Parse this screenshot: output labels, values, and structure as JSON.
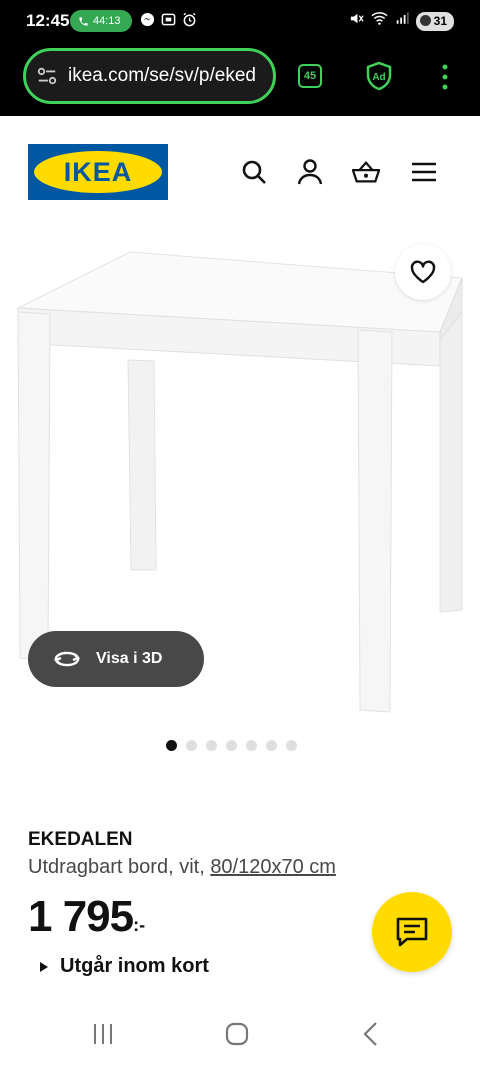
{
  "status_bar": {
    "time": "12:45",
    "call_timer": "44:13",
    "battery": "31",
    "icons_left": [
      "messenger-icon",
      "screenshot-icon",
      "alarm-icon"
    ],
    "icons_right": [
      "mute-icon",
      "wifi-icon",
      "signal-icon",
      "battery-icon"
    ]
  },
  "browser": {
    "url": "ikea.com/se/sv/p/eked",
    "tab_count": "45",
    "ad_badge": "Ad",
    "accent_color": "#3fd15a"
  },
  "header": {
    "logo_text": "IKEA",
    "logo_colors": {
      "blue": "#0058a3",
      "yellow": "#ffdb00"
    },
    "icons": [
      "search-icon",
      "account-icon",
      "basket-icon",
      "menu-icon"
    ]
  },
  "product": {
    "view_3d_label": "Visa i 3D",
    "carousel_count": 7,
    "carousel_active": 0,
    "name": "EKEDALEN",
    "description": "Utdragbart bord, vit, ",
    "dimensions": "80/120x70 cm",
    "price": "1 795",
    "price_suffix": ":-",
    "availability": "Utgår inom kort"
  },
  "nav_bar": {
    "buttons": [
      "recents-icon",
      "home-icon",
      "back-icon"
    ]
  }
}
